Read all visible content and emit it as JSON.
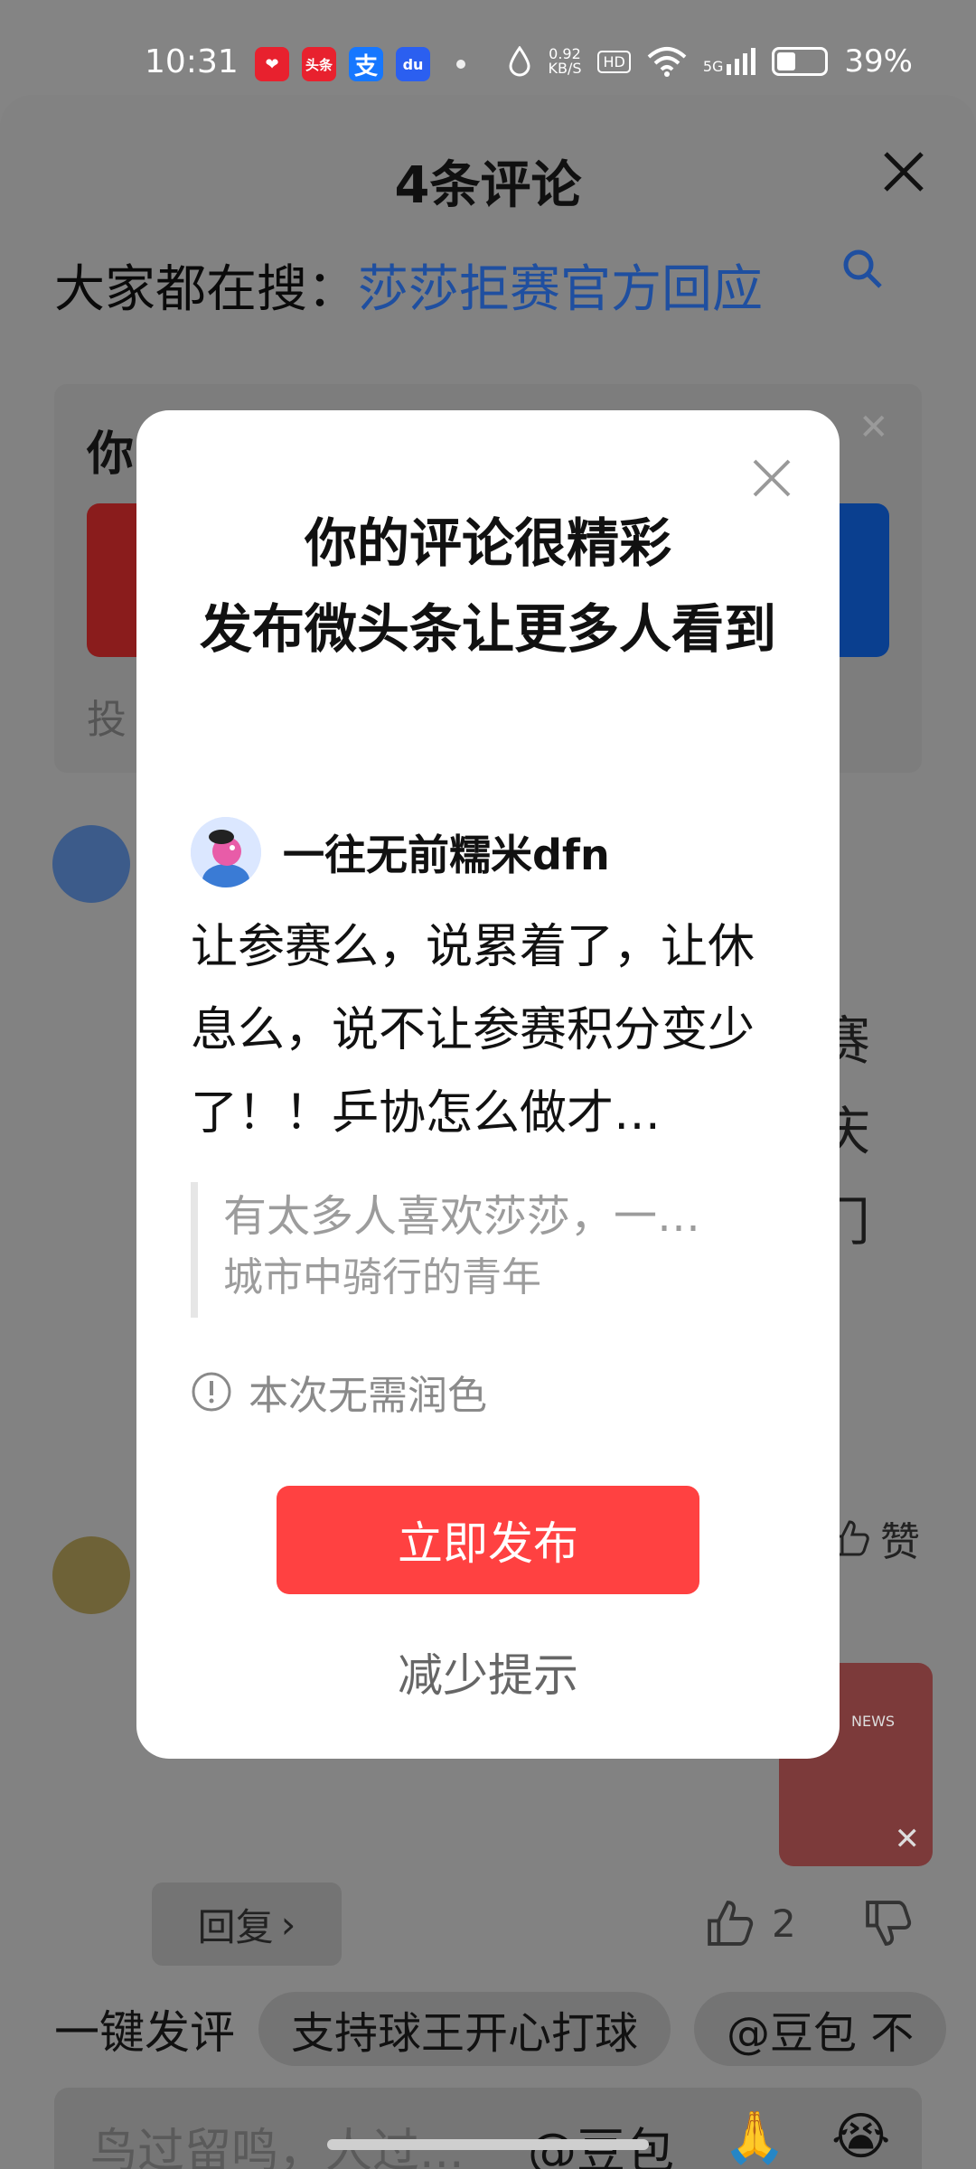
{
  "status_bar": {
    "time": "10:31",
    "apps": [
      {
        "icon": "heart-app-icon",
        "label": "",
        "color": "#e8212e"
      },
      {
        "icon": "toutiao-app-icon",
        "label": "头条",
        "color": "#e8212e"
      },
      {
        "icon": "alipay-app-icon",
        "label": "支",
        "color": "#1677ff"
      },
      {
        "icon": "baidu-app-icon",
        "label": "du",
        "color": "#2b5ff0"
      }
    ],
    "net_speed_value": "0.92",
    "net_speed_unit": "KB/S",
    "hd": "HD",
    "signal": "5G",
    "battery": "39%",
    "battery_level": 0.39
  },
  "sheet": {
    "title": "4条评论",
    "search_prefix": "大家都在搜：",
    "search_link": "莎莎拒赛官方回应",
    "card_title_fragment": "你",
    "card_footer_fragment": "投",
    "side_fragments": [
      "赛",
      "庆",
      "门"
    ],
    "like_label": "赞",
    "reply_label": "回复",
    "reply_like_count": "2",
    "quick_comment_label": "一键发评",
    "quick_chips": [
      "支持球王开心打球",
      "@豆包 不"
    ],
    "input_placeholder": "鸟过留鸣，人过...",
    "input_mention": "@豆包",
    "emojis": [
      "🙏",
      "😭"
    ],
    "news_card_label": "NEWS"
  },
  "modal": {
    "title": "你的评论很精彩\n发布微头条让更多人看到",
    "author_name": "一往无前糯米dfn",
    "comment_text": "让参赛么，说累着了，让休息么，说不让参赛积分变少了！！乒协怎么做才…",
    "quote_text": "有太多人喜欢莎莎，一…",
    "quote_author": "城市中骑行的青年",
    "note": "本次无需润色",
    "publish_label": "立即发布",
    "less_label": "减少提示"
  }
}
